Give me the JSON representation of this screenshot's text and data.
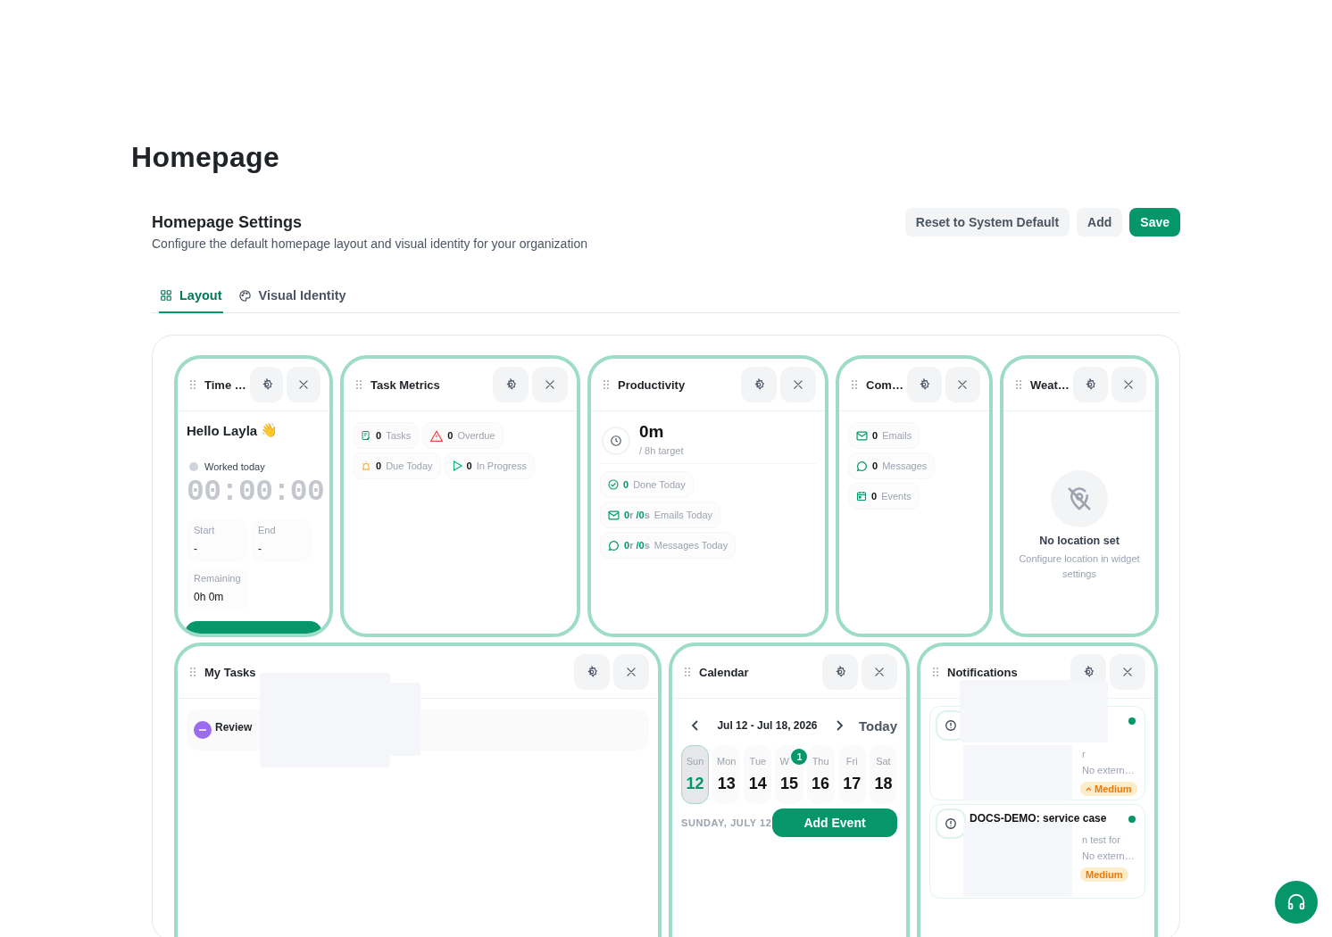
{
  "page_title": "Homepage",
  "settings": {
    "title": "Homepage Settings",
    "description": "Configure the default homepage layout and visual identity for your organization",
    "buttons": [
      {
        "label": "Reset to System Default",
        "kind": "secondary"
      },
      {
        "label": "Add",
        "kind": "secondary"
      },
      {
        "label": "Save",
        "kind": "primary"
      }
    ]
  },
  "tabs": [
    {
      "label": "Layout",
      "selected": true
    },
    {
      "label": "Visual Identity",
      "selected": false
    }
  ],
  "widgets": [
    {
      "kind": "timer",
      "title": "Time …",
      "greeting": "Hello Layla",
      "emoji": "👋",
      "status": "Worked today",
      "clock": "00:00:00",
      "fields": [
        {
          "label": "Start",
          "value": "-"
        },
        {
          "label": "End",
          "value": "-"
        },
        {
          "label": "Remaining",
          "value": "0h 0m"
        }
      ]
    },
    {
      "kind": "task_metrics",
      "title": "Task Metrics",
      "chips": [
        {
          "value": "0",
          "label": "Tasks"
        },
        {
          "value": "0",
          "label": "Overdue"
        },
        {
          "value": "0",
          "label": "Due Today"
        },
        {
          "value": "0",
          "label": "In Progress"
        }
      ]
    },
    {
      "kind": "productivity",
      "title": "Productivity",
      "total": "0m",
      "target": "/ 8h target",
      "rows": [
        {
          "parts": [
            "0"
          ],
          "label": "Done Today"
        },
        {
          "parts": [
            "0",
            "r",
            "/0",
            "s"
          ],
          "label": "Emails Today"
        },
        {
          "parts": [
            "0",
            "r",
            "/0",
            "s"
          ],
          "label": "Messages Today"
        }
      ]
    },
    {
      "kind": "communications",
      "title": "Com…",
      "chips": [
        {
          "value": "0",
          "label": "Emails"
        },
        {
          "value": "0",
          "label": "Messages"
        },
        {
          "value": "0",
          "label": "Events"
        }
      ]
    },
    {
      "kind": "weather",
      "title": "Weat…",
      "message": "No location set",
      "hint": "Configure location in widget settings"
    },
    {
      "kind": "tasks",
      "title": "My Tasks",
      "tasks": [
        {
          "title": "Review"
        }
      ]
    },
    {
      "kind": "calendar",
      "title": "Calendar",
      "range": "Jul 12 - Jul 18, 2026",
      "today": "Today",
      "days": [
        {
          "name": "Sun",
          "date": "12",
          "selected": true
        },
        {
          "name": "Mon",
          "date": "13",
          "selected": false
        },
        {
          "name": "Tue",
          "date": "14",
          "selected": false
        },
        {
          "name": "W",
          "date": "15",
          "selected": false,
          "badge": "1"
        },
        {
          "name": "Thu",
          "date": "16",
          "selected": false
        },
        {
          "name": "Fri",
          "date": "17",
          "selected": false
        },
        {
          "name": "Sat",
          "date": "18",
          "selected": false
        }
      ],
      "selected_label": "SUNDAY, JULY 12",
      "add_button": "Add Event"
    },
    {
      "kind": "notifications",
      "title": "Notifications",
      "items": [
        {
          "lines": [
            "r",
            "No extern…"
          ],
          "priority": "Medium",
          "caret": true
        },
        {
          "title": "DOCS-DEMO: service case",
          "lines": [
            "n test for",
            "No extern…"
          ],
          "priority": "Medium",
          "caret": false
        }
      ]
    }
  ]
}
